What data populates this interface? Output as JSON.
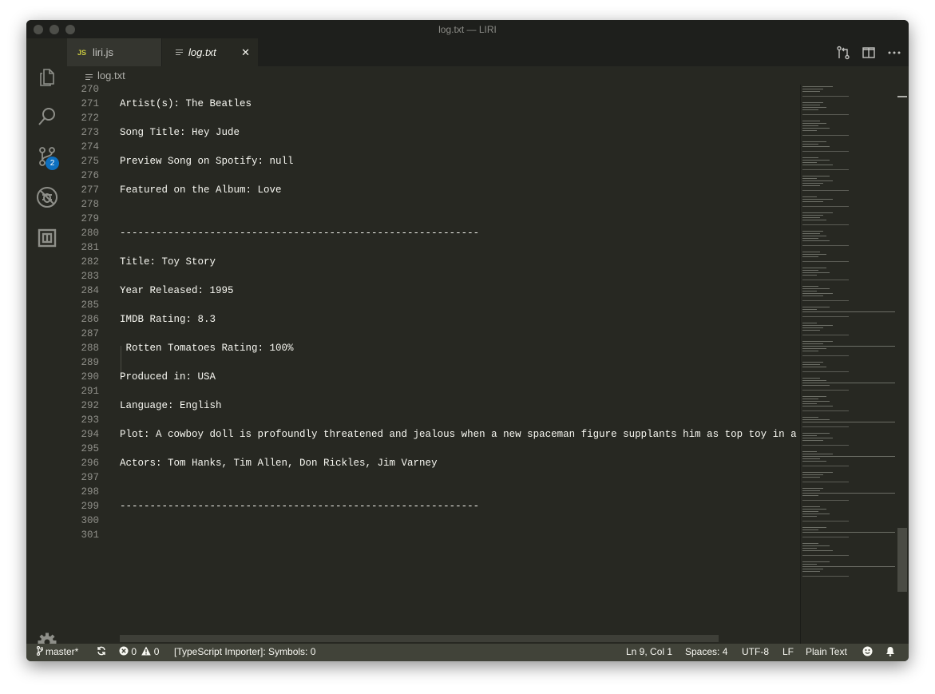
{
  "window": {
    "title": "log.txt — LIRI"
  },
  "activity_bar": {
    "items": [
      {
        "icon": "files-icon"
      },
      {
        "icon": "search-icon"
      },
      {
        "icon": "source-control-icon",
        "badge": "2"
      },
      {
        "icon": "debug-icon"
      },
      {
        "icon": "extensions-icon"
      }
    ],
    "settings_icon": "gear-icon"
  },
  "tabs": [
    {
      "label": "liri.js",
      "icon": "JS",
      "active": false
    },
    {
      "label": "log.txt",
      "active": true,
      "close": "✕"
    }
  ],
  "tab_actions": [
    "open-changes-icon",
    "split-editor-icon",
    "more-actions-icon"
  ],
  "breadcrumb": {
    "label": "log.txt"
  },
  "editor": {
    "lines": [
      {
        "num": "270",
        "text": ""
      },
      {
        "num": "271",
        "text": "Artist(s): The Beatles"
      },
      {
        "num": "272",
        "text": ""
      },
      {
        "num": "273",
        "text": "Song Title: Hey Jude"
      },
      {
        "num": "274",
        "text": ""
      },
      {
        "num": "275",
        "text": "Preview Song on Spotify: null"
      },
      {
        "num": "276",
        "text": ""
      },
      {
        "num": "277",
        "text": "Featured on the Album: Love"
      },
      {
        "num": "278",
        "text": ""
      },
      {
        "num": "279",
        "text": ""
      },
      {
        "num": "280",
        "text": "------------------------------------------------------------"
      },
      {
        "num": "281",
        "text": ""
      },
      {
        "num": "282",
        "text": "Title: Toy Story"
      },
      {
        "num": "283",
        "text": ""
      },
      {
        "num": "284",
        "text": "Year Released: 1995"
      },
      {
        "num": "285",
        "text": ""
      },
      {
        "num": "286",
        "text": "IMDB Rating: 8.3"
      },
      {
        "num": "287",
        "text": ""
      },
      {
        "num": "288",
        "text": " Rotten Tomatoes Rating: 100%"
      },
      {
        "num": "289",
        "text": ""
      },
      {
        "num": "290",
        "text": "Produced in: USA"
      },
      {
        "num": "291",
        "text": ""
      },
      {
        "num": "292",
        "text": "Language: English"
      },
      {
        "num": "293",
        "text": ""
      },
      {
        "num": "294",
        "text": "Plot: A cowboy doll is profoundly threatened and jealous when a new spaceman figure supplants him as top toy in a boy'"
      },
      {
        "num": "295",
        "text": ""
      },
      {
        "num": "296",
        "text": "Actors: Tom Hanks, Tim Allen, Don Rickles, Jim Varney"
      },
      {
        "num": "297",
        "text": ""
      },
      {
        "num": "298",
        "text": ""
      },
      {
        "num": "299",
        "text": "------------------------------------------------------------"
      },
      {
        "num": "300",
        "text": ""
      },
      {
        "num": "301",
        "text": ""
      }
    ]
  },
  "status_bar": {
    "branch": "master*",
    "sync_icon": "sync-icon",
    "errors": "0",
    "warnings": "0",
    "importer": "[TypeScript Importer]: Symbols: 0",
    "position": "Ln 9, Col 1",
    "spaces": "Spaces: 4",
    "encoding": "UTF-8",
    "eol": "LF",
    "language": "Plain Text",
    "feedback_icon": "smiley-icon",
    "notifications_icon": "bell-icon"
  },
  "colors": {
    "editor_bg": "#272822",
    "text": "#f8f8f2",
    "line_number": "#90908a",
    "status_bar": "#414339",
    "badge": "#0e70c0",
    "js_icon": "#cbcb41"
  }
}
